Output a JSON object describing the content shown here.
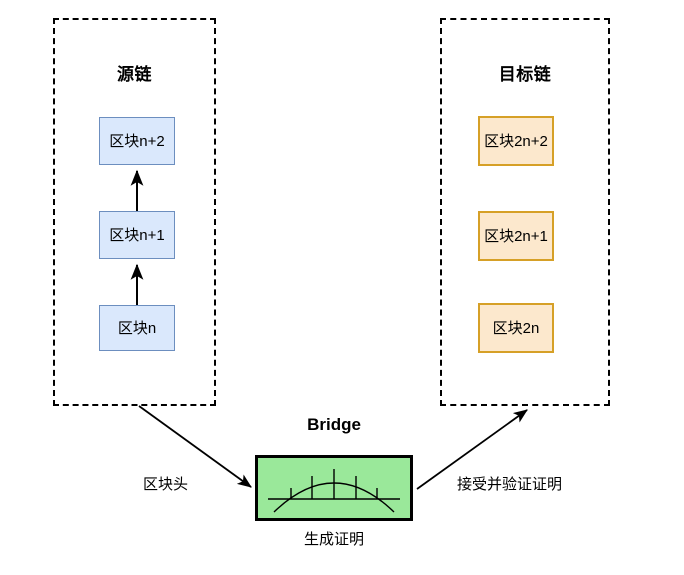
{
  "diagram": {
    "title_hidden": "",
    "panels": [
      {
        "id": "source",
        "title": "源链",
        "blocks": [
          {
            "label": "区块n+2"
          },
          {
            "label": "区块n+1"
          },
          {
            "label": "区块n"
          }
        ]
      },
      {
        "id": "target",
        "title": "目标链",
        "blocks": [
          {
            "label": "区块2n+2"
          },
          {
            "label": "区块2n+1"
          },
          {
            "label": "区块2n"
          }
        ]
      }
    ],
    "bridge": {
      "title": "Bridge",
      "caption": "生成证明",
      "icon_name": "bridge-arch-icon"
    },
    "edges": [
      {
        "id": "source-to-bridge",
        "label": "区块头"
      },
      {
        "id": "bridge-to-target",
        "label": "接受并验证证明"
      }
    ],
    "colors": {
      "source_block_fill": "#dae8fc",
      "source_block_stroke": "#6c8ebf",
      "target_block_fill": "#fce8cd",
      "target_block_stroke": "#d6a027",
      "bridge_fill": "#9ae89a",
      "bridge_stroke": "#000000",
      "panel_stroke": "#000000",
      "arrow_stroke": "#000000",
      "background": "#ffffff"
    }
  }
}
